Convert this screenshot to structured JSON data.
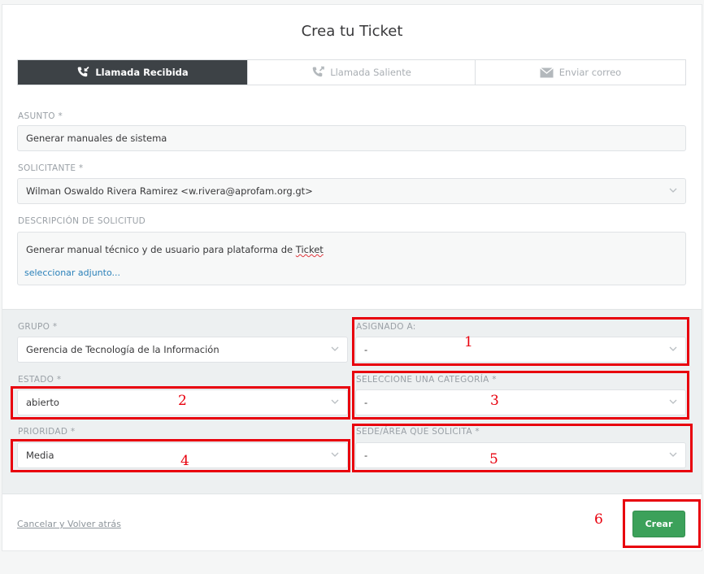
{
  "page": {
    "title": "Crea tu Ticket"
  },
  "tabs": [
    {
      "label": "Llamada Recibida",
      "icon": "phone-incoming-icon",
      "active": true
    },
    {
      "label": "Llamada Saliente",
      "icon": "phone-outgoing-icon",
      "active": false
    },
    {
      "label": "Enviar correo",
      "icon": "envelope-icon",
      "active": false
    }
  ],
  "form": {
    "asunto": {
      "label": "ASUNTO *",
      "value": "Generar manuales de sistema"
    },
    "solicitante": {
      "label": "SOLICITANTE *",
      "value": "Wilman Oswaldo Rivera Ramirez <w.rivera@aprofam.org.gt>"
    },
    "descripcion": {
      "label": "DESCRIPCIÓN DE SOLICITUD",
      "text_before": "Generar manual técnico y de usuario para plataforma de ",
      "text_misspelled": "Ticket",
      "attach_link": "seleccionar adjunto..."
    },
    "grupo": {
      "label": "GRUPO *",
      "value": "Gerencia de Tecnología de la Información"
    },
    "asignado": {
      "label": "ASIGNADO A:",
      "value": "-"
    },
    "estado": {
      "label": "ESTADO *",
      "value": "abierto"
    },
    "categoria": {
      "label": "SELECCIONE UNA CATEGORÍA *",
      "value": "-"
    },
    "prioridad": {
      "label": "PRIORIDAD *",
      "value": "Media"
    },
    "sede": {
      "label": "SEDE/ÁREA QUE SOLICITA *",
      "value": "-"
    }
  },
  "footer": {
    "cancel_label": "Cancelar y Volver atrás",
    "create_label": "Crear"
  },
  "annotations": [
    "1",
    "2",
    "3",
    "4",
    "5",
    "6"
  ],
  "colors": {
    "active_tab": "#3d4246",
    "create_button": "#3ca15a",
    "annotation": "#e8000d",
    "link": "#2a80b9"
  }
}
